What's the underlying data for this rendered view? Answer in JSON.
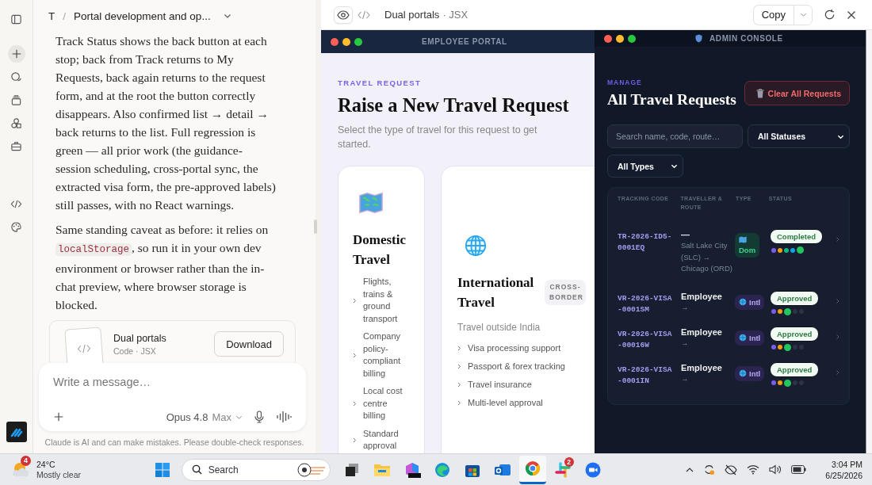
{
  "chat": {
    "breadcrumb": {
      "project": "T",
      "separator": "/",
      "title": "Portal development and op..."
    },
    "paragraph_1": "Track Status shows the back button at each stop; back from Track returns to My Requests, back again returns to the request form, and at the root the button correctly disappears. Also confirmed list → detail → back returns to the list. Full regression is green — all prior work (the guidance-session scheduling, cross-portal sync, the extracted visa form, the pre-approved labels) still passes, with no React warnings.",
    "paragraph_2": {
      "before": "Same standing caveat as before: it relies on",
      "code": "localStorage",
      "after": ", so run it in your own dev environment or browser rather than the in-chat preview, where browser storage is blocked."
    },
    "artifact": {
      "name": "Dual portals",
      "meta": "Code · JSX",
      "action": "Download"
    },
    "composer": {
      "placeholder": "Write a message…",
      "model": "Opus 4.8",
      "effort": "Max"
    },
    "disclaimer": "Claude is AI and can make mistakes. Please double-check responses."
  },
  "preview": {
    "view_toggle": [
      {
        "kind": "preview",
        "selected": true
      },
      {
        "kind": "code",
        "selected": false
      }
    ],
    "title": "Dual portals",
    "subtitle": "· JSX",
    "copy": "Copy"
  },
  "employee_portal": {
    "window_title": "EMPLOYEE PORTAL",
    "eyebrow": "TRAVEL REQUEST",
    "heading": "Raise a New Travel Request",
    "subheading": "Select the type of travel for this request to get started.",
    "cards": [
      {
        "kind": "domestic",
        "title": "Domestic Travel",
        "features": [
          "Flights, trains & ground transport",
          "Company policy-compliant billing",
          "Local cost centre billing",
          "Standard approval"
        ]
      },
      {
        "kind": "international",
        "title": "International Travel",
        "badge": "CROSS-BORDER",
        "description": "Travel outside India",
        "features": [
          "Visa processing support",
          "Passport & forex tracking",
          "Travel insurance",
          "Multi-level approval"
        ]
      }
    ]
  },
  "admin_console": {
    "window_title": "ADMIN CONSOLE",
    "eyebrow": "MANAGE",
    "heading": "All Travel Requests",
    "clear_button": "Clear All Requests",
    "search": {
      "placeholder": "Search name, code, route…"
    },
    "filters": [
      "All Statuses",
      "All Types"
    ],
    "table": {
      "columns": [
        "TRACKING CODE",
        "TRAVELLER & ROUTE",
        "TYPE",
        "STATUS"
      ],
      "rows": [
        {
          "code": "TR-2026-ID5-0001EQ",
          "traveller": "—",
          "route": "Salt Lake City (SLC) → Chicago (ORD)",
          "type": {
            "kind": "domestic",
            "label": "Dom"
          },
          "status": "Completed",
          "steps": [
            {
              "color": "#7c5cf0",
              "current": false
            },
            {
              "color": "#f59e0b",
              "current": false
            },
            {
              "color": "#10b981",
              "current": false
            },
            {
              "color": "#0ea5e9",
              "current": false
            },
            {
              "color": "#22c55e",
              "current": true
            }
          ]
        },
        {
          "code": "VR-2026-VISA-0001SM",
          "traveller": "Employee",
          "route": "→",
          "type": {
            "kind": "international",
            "label": "Intl"
          },
          "status": "Approved",
          "steps": [
            {
              "color": "#7c5cf0",
              "current": false
            },
            {
              "color": "#f59e0b",
              "current": false
            },
            {
              "color": "#22c55e",
              "current": true
            },
            {
              "color": "#2c3342",
              "current": false
            },
            {
              "color": "#2c3342",
              "current": false
            }
          ]
        },
        {
          "code": "VR-2026-VISA-00016W",
          "traveller": "Employee",
          "route": "→",
          "type": {
            "kind": "international",
            "label": "Intl"
          },
          "status": "Approved",
          "steps": [
            {
              "color": "#7c5cf0",
              "current": false
            },
            {
              "color": "#f59e0b",
              "current": false
            },
            {
              "color": "#22c55e",
              "current": true
            },
            {
              "color": "#2c3342",
              "current": false
            },
            {
              "color": "#2c3342",
              "current": false
            }
          ]
        },
        {
          "code": "VR-2026-VISA-0001IN",
          "traveller": "Employee",
          "route": "→",
          "type": {
            "kind": "international",
            "label": "Intl"
          },
          "status": "Approved",
          "steps": [
            {
              "color": "#7c5cf0",
              "current": false
            },
            {
              "color": "#f59e0b",
              "current": false
            },
            {
              "color": "#22c55e",
              "current": true
            },
            {
              "color": "#2c3342",
              "current": false
            },
            {
              "color": "#2c3342",
              "current": false
            }
          ]
        }
      ]
    }
  },
  "taskbar": {
    "weather": {
      "badge": "4",
      "temperature": "24°C",
      "condition": "Mostly clear"
    },
    "search": {
      "placeholder": "Search"
    },
    "apps": [
      {
        "kind": "task-view",
        "selected": false
      },
      {
        "kind": "folder",
        "selected": false
      },
      {
        "kind": "m365",
        "selected": false
      },
      {
        "kind": "edge",
        "selected": false
      },
      {
        "kind": "store",
        "selected": false
      },
      {
        "kind": "outlook",
        "selected": false
      },
      {
        "kind": "chrome",
        "selected": true
      },
      {
        "kind": "slack",
        "selected": false,
        "badge": "2"
      },
      {
        "kind": "zoom",
        "selected": false
      }
    ],
    "clock": {
      "time": "3:04 PM",
      "date": "6/25/2026"
    }
  }
}
